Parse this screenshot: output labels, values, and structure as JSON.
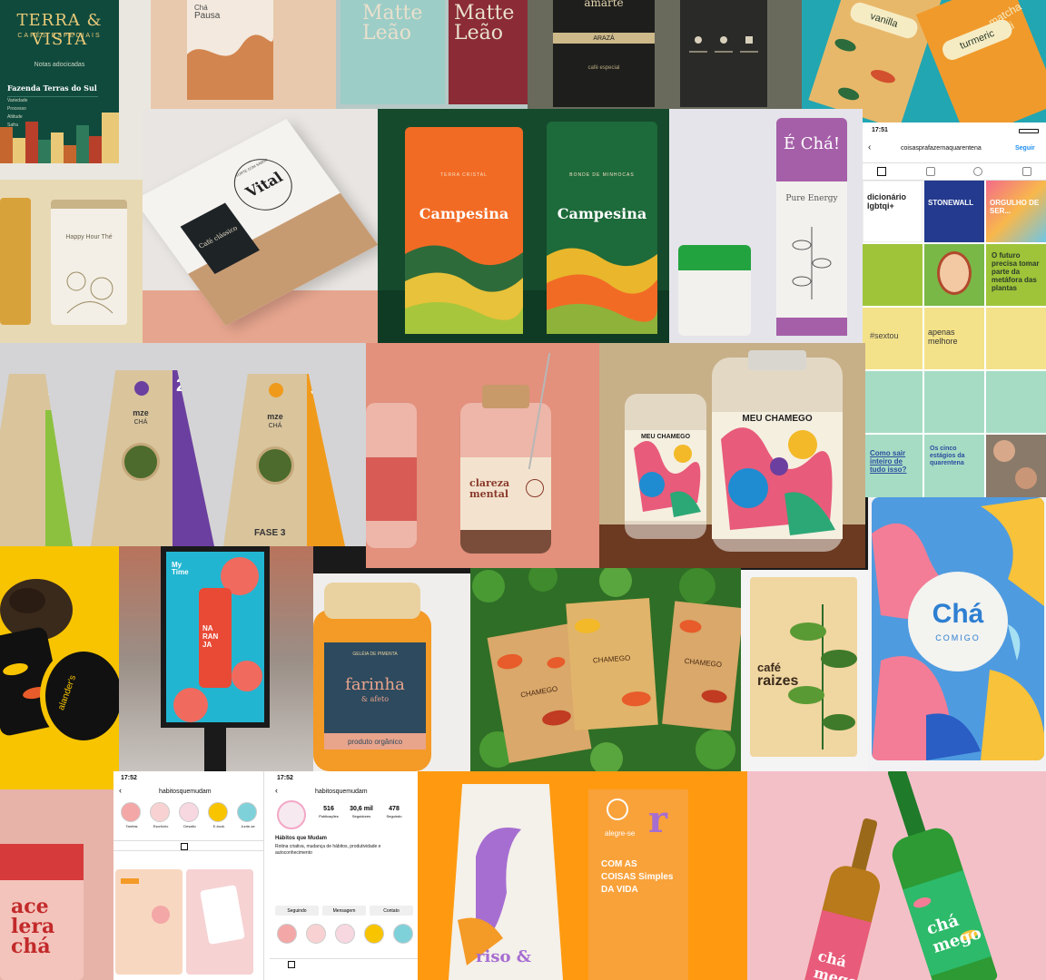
{
  "tiles": {
    "t1": {
      "brand": "TERRA & VISTA",
      "sub": "CAFÉS ESPECIAIS",
      "notes": "Notas adocicadas",
      "origin": "Fazenda Terras do Sul",
      "lines": [
        "Variedade",
        "Processo",
        "Altitude",
        "Safra"
      ]
    },
    "t2": {
      "line1": "Chá",
      "line2": "Pausa"
    },
    "t3": {
      "brand1": "Matte",
      "brand2": "Leão"
    },
    "t4": {
      "left_brand": "amarte",
      "left_flavor": "ARAZÁ",
      "left_sub": "café especial"
    },
    "t5": {
      "left": "vanilla",
      "right": "turmeric",
      "corner": "matcha chai"
    },
    "t6": {
      "label": "Happy Hour Thé"
    },
    "t7": {
      "brand": "Vital",
      "flavor": "Café clássico",
      "ring": "FORTE COM SABOR"
    },
    "t8": {
      "left_brand": "Campesina",
      "left_top": "TERRA CRISTAL",
      "right_brand": "Campesina",
      "right_top": "BONDE DE MINHOCAS"
    },
    "t9": {
      "brand": "É Chá!",
      "flavor": "Pure Energy"
    },
    "t10": {
      "time": "17:51",
      "title": "coisasprafazernaquarentena",
      "follow": "Seguir",
      "grid": [
        "dicionário lgbtqi+",
        "STONEWALL",
        "ORGULHO DE SER...",
        "",
        "",
        "O futuro precisa tomar parte da metáfora das plantas",
        "#sextou",
        "apenas melhore",
        "",
        "",
        "",
        "",
        "Como sair inteiro de tudo isso?",
        "Os cinco estágios da quarentena",
        ""
      ]
    },
    "t11": {
      "brand": "mze",
      "flavor": "CHÁ",
      "step": "FASE 3",
      "num_left": "1",
      "num_mid": "2",
      "num_right": "3"
    },
    "t12": {
      "label1": "clareza",
      "label2": "mental"
    },
    "t13": {
      "brand": "MEU CHAMEGO",
      "small": "MEU CHAMEGO"
    },
    "t14": {
      "brand": "alander's"
    },
    "t15": {
      "brand1": "My",
      "brand2": "Time",
      "product": "NA RAN JA"
    },
    "t16": {
      "top": "GELÉIA DE PIMENTA",
      "brand": "farinha",
      "sub": "& afeto",
      "bottom": "produto orgânico"
    },
    "t17": {
      "pack": "CHAMEGO"
    },
    "t18": {
      "brand1": "café",
      "brand2": "raizes"
    },
    "t19": {
      "brand": "Chá",
      "sub": "COMIGO"
    },
    "t20": {
      "brand1": "ace",
      "brand2": "lera",
      "brand3": "chá"
    },
    "t21": {
      "left_time": "17:52",
      "left_title": "habitosquemudam",
      "right_time": "17:52",
      "right_title": "habitosquemudam",
      "stats": [
        {
          "n": "516",
          "l": "Publicações"
        },
        {
          "n": "30,6 mil",
          "l": "Seguidores"
        },
        {
          "n": "478",
          "l": "Seguindo"
        }
      ],
      "name": "Hábitos que Mudam",
      "bio": "Rotina criativa, mudança de hábitos, produtividade e autoconhecimento",
      "buttons": [
        "Seguindo",
        "Mensagem",
        "Contato"
      ],
      "highlights": [
        "Tarefas",
        "Escritório",
        "Desafio",
        "E-book",
        "Junte-se"
      ]
    },
    "t22": {
      "left_brand": "riso &",
      "right_brand": "alegre-se",
      "right_sub": "COM AS COISAS Simples DA VIDA"
    },
    "t23": {
      "label": "chá mego"
    }
  },
  "colors": {
    "green": "#104a3d",
    "orange": "#ff9a10",
    "teal": "#22a6b2",
    "pink": "#f4c0c8"
  }
}
